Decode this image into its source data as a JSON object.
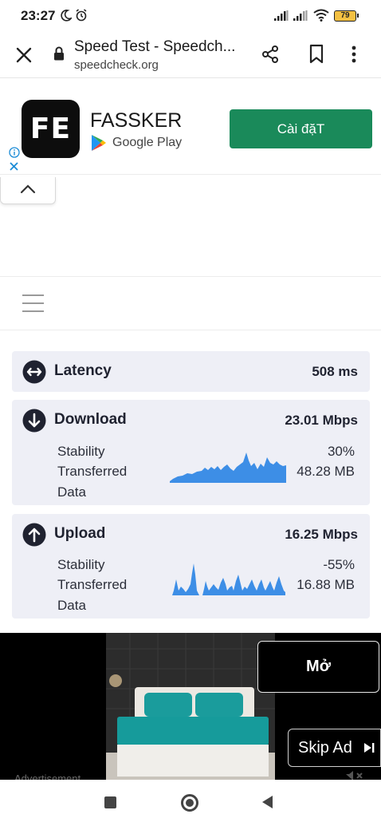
{
  "status_bar": {
    "time": "23:27",
    "battery": "79"
  },
  "browser": {
    "title": "Speed Test - Speedch...",
    "url": "speedcheck.org"
  },
  "ad_top": {
    "logo_text": "FE",
    "app_name": "FASSKER",
    "store": "Google Play",
    "install_label": "Cài đặT",
    "install_color": "#1a8a5a"
  },
  "results": {
    "latency": {
      "label": "Latency",
      "value": "508 ms"
    },
    "download": {
      "label": "Download",
      "value": "23.01 Mbps",
      "stability_label": "Stability",
      "stability_value": "30%",
      "transferred_label_1": "Transferred",
      "transferred_label_2": "Data",
      "transferred_value": "48.28 MB"
    },
    "upload": {
      "label": "Upload",
      "value": "16.25 Mbps",
      "stability_label": "Stability",
      "stability_value": "-55%",
      "transferred_label_1": "Transferred",
      "transferred_label_2": "Data",
      "transferred_value": "16.88 MB"
    },
    "chart_color": "#3d8ee6"
  },
  "ad_bottom": {
    "open_label": "Mở",
    "skip_label": "Skip Ad",
    "advertisement_label": "Advertisement"
  },
  "icons": {
    "close": "close-icon",
    "lock": "lock-icon",
    "share": "share-icon",
    "bookmark": "bookmark-icon",
    "menu": "more-vert-icon",
    "latency": "arrows-horizontal-icon",
    "download": "arrow-down-circle-icon",
    "upload": "arrow-up-circle-icon"
  }
}
